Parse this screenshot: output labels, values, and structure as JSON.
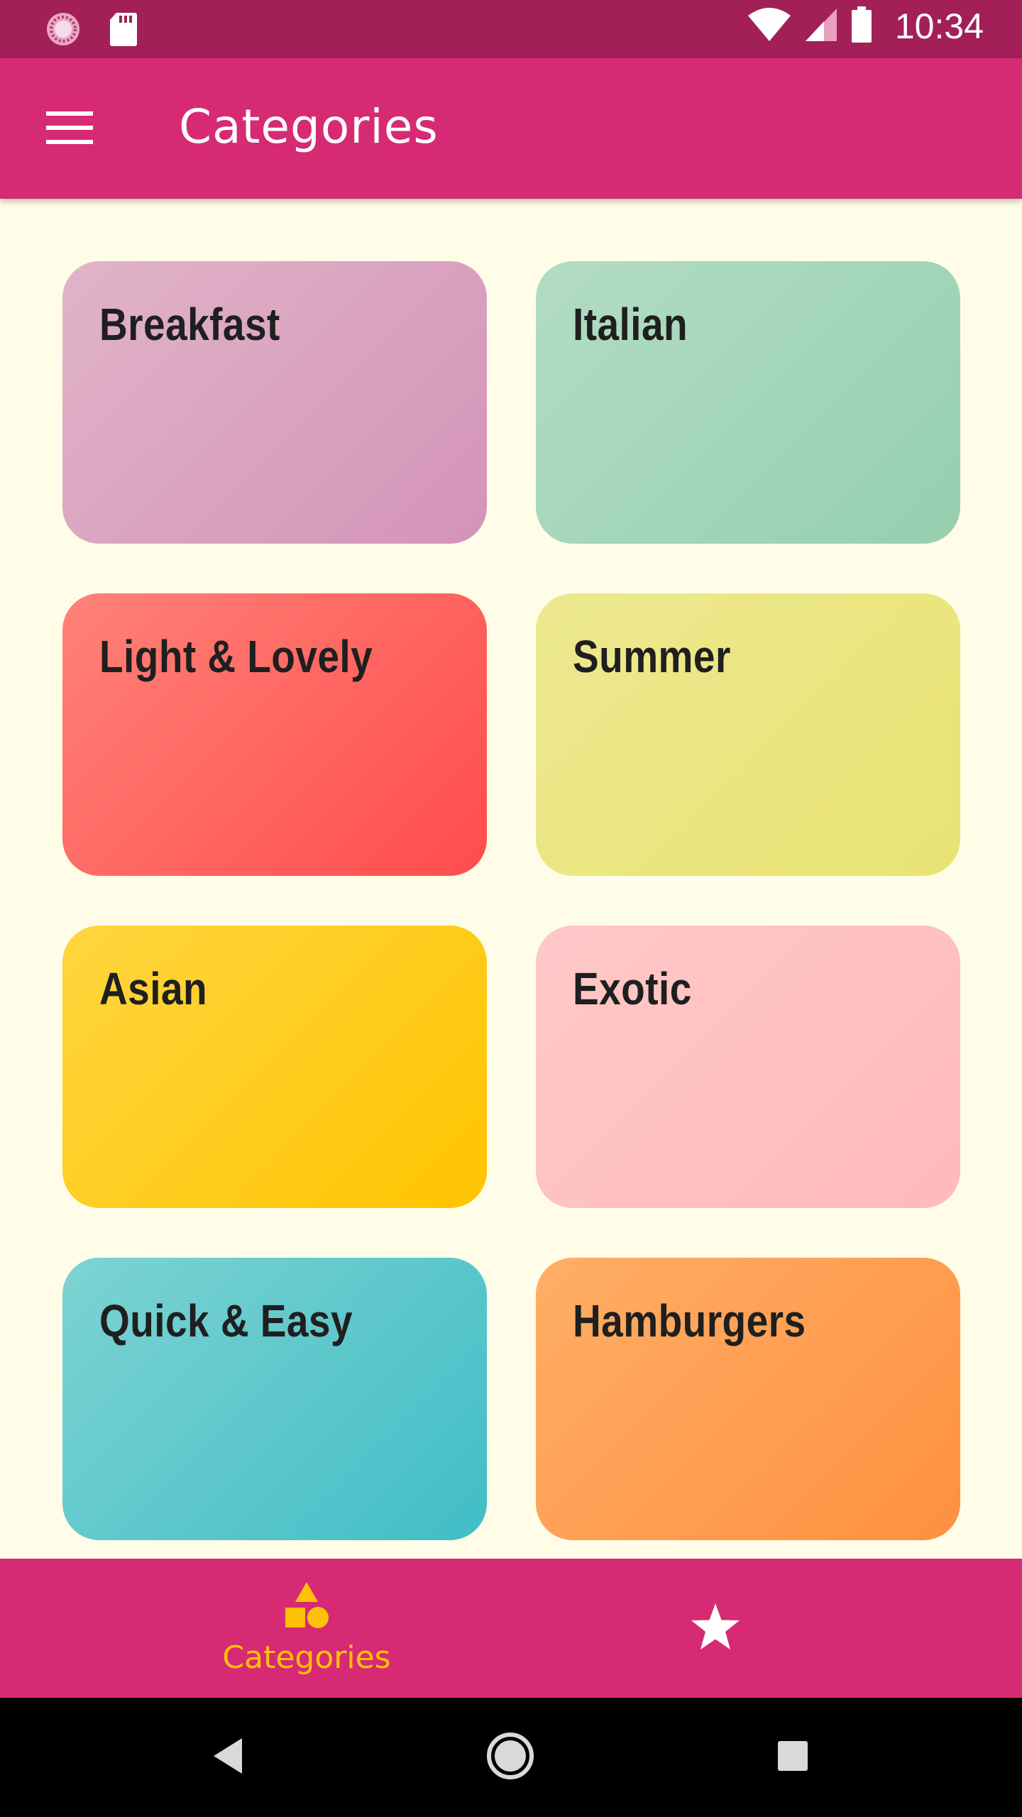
{
  "status_bar": {
    "time": "10:34",
    "left_icons": [
      "loading-icon",
      "sd-card-icon"
    ],
    "right_icons": [
      "wifi-icon",
      "cell-signal-icon",
      "battery-icon"
    ]
  },
  "app_bar": {
    "title": "Categories",
    "menu_icon": "hamburger-menu-icon"
  },
  "categories": [
    {
      "label": "Breakfast",
      "color_start": "#e0b4c8",
      "color_end": "#d493b8"
    },
    {
      "label": "Italian",
      "color_start": "#b2dcc4",
      "color_end": "#96cfb0"
    },
    {
      "label": "Light & Lovely",
      "color_start": "#ff8278",
      "color_end": "#ff4c4c"
    },
    {
      "label": "Summer",
      "color_start": "#ede890",
      "color_end": "#e8e372"
    },
    {
      "label": "Asian",
      "color_start": "#ffd640",
      "color_end": "#ffc400"
    },
    {
      "label": "Exotic",
      "color_start": "#ffc8c8",
      "color_end": "#ffbaba"
    },
    {
      "label": "Quick & Easy",
      "color_start": "#7dd3d3",
      "color_end": "#40bdc6"
    },
    {
      "label": "Hamburgers",
      "color_start": "#ffae66",
      "color_end": "#ff9040"
    }
  ],
  "bottom_nav": {
    "items": [
      {
        "label": "Categories",
        "icon": "category-shapes-icon",
        "selected": true
      },
      {
        "label": "",
        "icon": "star-icon",
        "selected": false
      }
    ],
    "active_color": "#ffc107"
  },
  "colors": {
    "status_bar": "#a31f57",
    "app_bar": "#d62a74",
    "background": "#fffde7"
  },
  "system_nav": {
    "buttons": [
      "back-icon",
      "home-icon",
      "recents-icon"
    ]
  }
}
